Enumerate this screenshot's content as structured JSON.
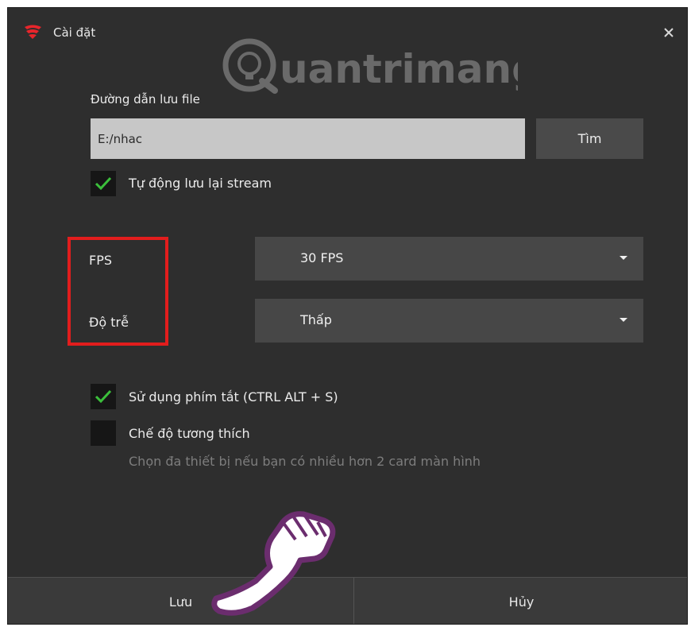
{
  "window": {
    "title": "Cài đặt",
    "watermark": "uantrimang"
  },
  "save_path": {
    "label": "Đường dẫn lưu file",
    "value": "E:/nhac",
    "browse_label": "Tìm"
  },
  "auto_save": {
    "label": "Tự động lưu lại stream",
    "checked": true
  },
  "fps": {
    "label": "FPS",
    "selected": "30 FPS"
  },
  "latency": {
    "label": "Độ trễ",
    "selected": "Thấp"
  },
  "hotkey": {
    "label": "Sử dụng phím tắt (CTRL ALT + S)",
    "checked": true
  },
  "compat": {
    "label": "Chế độ tương thích",
    "checked": false,
    "hint": "Chọn đa thiết bị nếu bạn có nhiều hơn 2 card màn hình"
  },
  "footer": {
    "save_label": "Lưu",
    "cancel_label": "Hủy"
  },
  "colors": {
    "background": "#2e2e2e",
    "control": "#474747",
    "input": "#c7c7c7",
    "check": "#3bbf3b",
    "highlight": "#e21d1d"
  },
  "icons": {
    "app": "garena-logo-icon",
    "close": "close-icon",
    "check": "checkmark-icon",
    "caret": "caret-down-icon"
  }
}
